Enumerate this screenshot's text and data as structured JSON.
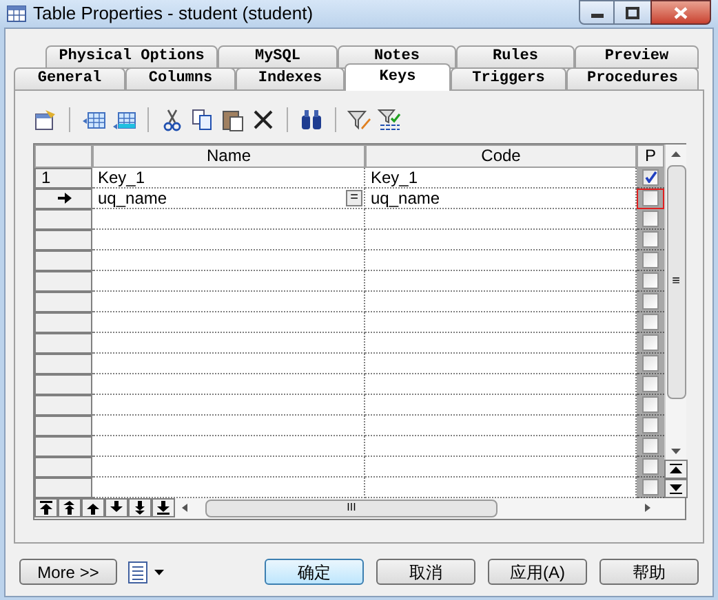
{
  "window": {
    "title": "Table Properties - student (student)"
  },
  "tab_rows": [
    [
      {
        "label": "Physical Options",
        "selected": false
      },
      {
        "label": "MySQL",
        "selected": false
      },
      {
        "label": "Notes",
        "selected": false
      },
      {
        "label": "Rules",
        "selected": false
      },
      {
        "label": "Preview",
        "selected": false
      }
    ],
    [
      {
        "label": "General",
        "selected": false
      },
      {
        "label": "Columns",
        "selected": false
      },
      {
        "label": "Indexes",
        "selected": false
      },
      {
        "label": "Keys",
        "selected": true
      },
      {
        "label": "Triggers",
        "selected": false
      },
      {
        "label": "Procedures",
        "selected": false
      }
    ]
  ],
  "grid": {
    "columns": [
      "Name",
      "Code",
      "P"
    ],
    "rows": [
      {
        "kind": "number",
        "number": "1",
        "name": "Key_1",
        "code": "Key_1",
        "primary": true,
        "focused": false
      },
      {
        "kind": "current",
        "name": "uq_name",
        "edit_button": "=",
        "code": "uq_name",
        "primary": false,
        "focused": true
      },
      {
        "kind": "blank",
        "primary": false,
        "focused": false
      },
      {
        "kind": "blank",
        "primary": false,
        "focused": false
      },
      {
        "kind": "blank",
        "primary": false,
        "focused": false
      },
      {
        "kind": "blank",
        "primary": false,
        "focused": false
      },
      {
        "kind": "blank",
        "primary": false,
        "focused": false
      },
      {
        "kind": "blank",
        "primary": false,
        "focused": false
      },
      {
        "kind": "blank",
        "primary": false,
        "focused": false
      },
      {
        "kind": "blank",
        "primary": false,
        "focused": false
      },
      {
        "kind": "blank",
        "primary": false,
        "focused": false
      },
      {
        "kind": "blank",
        "primary": false,
        "focused": false
      },
      {
        "kind": "blank",
        "primary": false,
        "focused": false
      },
      {
        "kind": "blank",
        "primary": false,
        "focused": false
      },
      {
        "kind": "blank",
        "primary": false,
        "focused": false
      },
      {
        "kind": "blank",
        "primary": false,
        "focused": false
      }
    ],
    "scroll_grip": "≡",
    "hscroll_grip": "III"
  },
  "footer": {
    "more": "More >>",
    "buttons": [
      {
        "label": "确定",
        "default": true
      },
      {
        "label": "取消",
        "default": false
      },
      {
        "label": "应用(A)",
        "default": false
      },
      {
        "label": "帮助",
        "default": false
      }
    ]
  }
}
